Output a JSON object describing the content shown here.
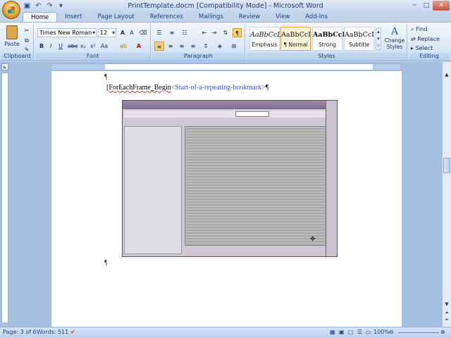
{
  "window": {
    "title": "PrintTemplate.docm [Compatibility Mode] - Microsoft Word"
  },
  "tabs": [
    {
      "label": "Home",
      "active": true
    },
    {
      "label": "Insert"
    },
    {
      "label": "Page Layout"
    },
    {
      "label": "References"
    },
    {
      "label": "Mailings"
    },
    {
      "label": "Review"
    },
    {
      "label": "View"
    },
    {
      "label": "Add-Ins"
    }
  ],
  "ribbon": {
    "clipboard": {
      "label": "Clipboard",
      "paste": "Paste"
    },
    "font": {
      "label": "Font",
      "name": "Times New Roman",
      "size": "12"
    },
    "paragraph": {
      "label": "Paragraph"
    },
    "styles": {
      "label": "Styles",
      "tiles": [
        {
          "sample": "AaBbCcL",
          "name": "Emphasis"
        },
        {
          "sample": "AaBbCcI",
          "name": "¶ Normal",
          "selected": true
        },
        {
          "sample": "AaBbCcI",
          "name": "Strong"
        },
        {
          "sample": "AaBbCcI",
          "name": "Subtitle"
        }
      ],
      "change": "Change Styles"
    },
    "editing": {
      "label": "Editing",
      "find": "Find",
      "replace": "Replace",
      "select": "Select"
    }
  },
  "document": {
    "field_text": "ForEachFrame_Begin",
    "field_comment": "<Start-of-a-repeating-bookmark>"
  },
  "status": {
    "page": "Page: 3 of 6",
    "words": "Words: 511",
    "zoom": "100%"
  },
  "colors": {
    "ribbon_blue": "#c3d4e9",
    "accent": "#15428b"
  }
}
